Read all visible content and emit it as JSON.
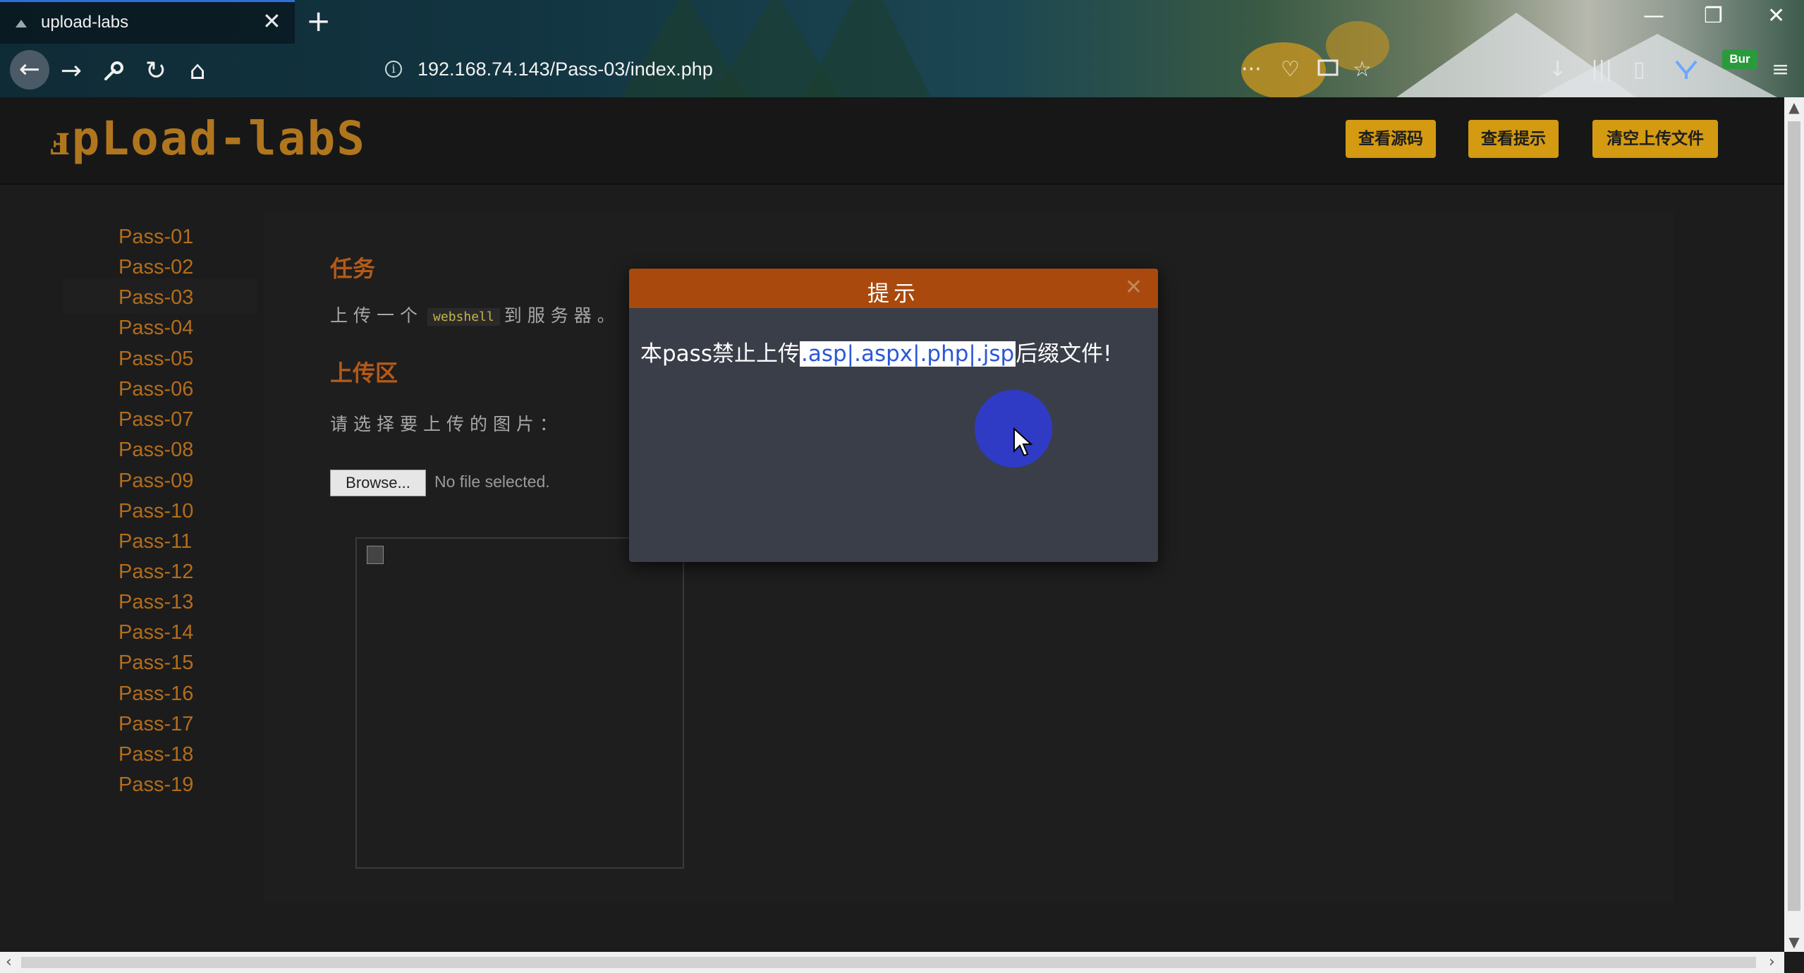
{
  "browser": {
    "tab_title": "upload-labs",
    "tab_close": "✕",
    "new_tab": "+",
    "url": "192.168.74.143/Pass-03/index.php",
    "burp_label": "Bur",
    "icons": {
      "back": "←",
      "forward": "→",
      "tools": "🔧",
      "reload": "↻",
      "home": "⌂",
      "more": "···",
      "pocket": "♡",
      "star": "☆",
      "download": "↓",
      "library": "|||",
      "sidebar": "▯",
      "menu": "≡",
      "minimize": "—",
      "restore": "❐",
      "close": "✕"
    }
  },
  "header": {
    "logo": "ⅎpLoad-labS",
    "buttons": [
      "查看源码",
      "查看提示",
      "清空上传文件"
    ]
  },
  "sidebar": {
    "items": [
      "Pass-01",
      "Pass-02",
      "Pass-03",
      "Pass-04",
      "Pass-05",
      "Pass-06",
      "Pass-07",
      "Pass-08",
      "Pass-09",
      "Pass-10",
      "Pass-11",
      "Pass-12",
      "Pass-13",
      "Pass-14",
      "Pass-15",
      "Pass-16",
      "Pass-17",
      "Pass-18",
      "Pass-19"
    ],
    "active": "Pass-03"
  },
  "main": {
    "task_title": "任务",
    "task_prefix": "上传一个",
    "task_code": "webshell",
    "task_suffix": "到服务器。",
    "upload_title": "上传区",
    "choose_label": "请选择要上传的图片：",
    "browse_label": "Browse...",
    "file_status": "No file selected."
  },
  "modal": {
    "title": "提示",
    "close": "✕",
    "msg_prefix": "本pass禁止上传",
    "msg_highlight": ".asp|.aspx|.php|.jsp",
    "msg_suffix": "后缀文件!"
  },
  "scroll": {
    "up": "▲",
    "down": "▼",
    "left": "‹",
    "right": "›"
  },
  "colors": {
    "accent": "#d39a12",
    "pass_link": "#b36d1c",
    "modal_title": "#a9490d",
    "highlight_text": "#2b57d6"
  }
}
